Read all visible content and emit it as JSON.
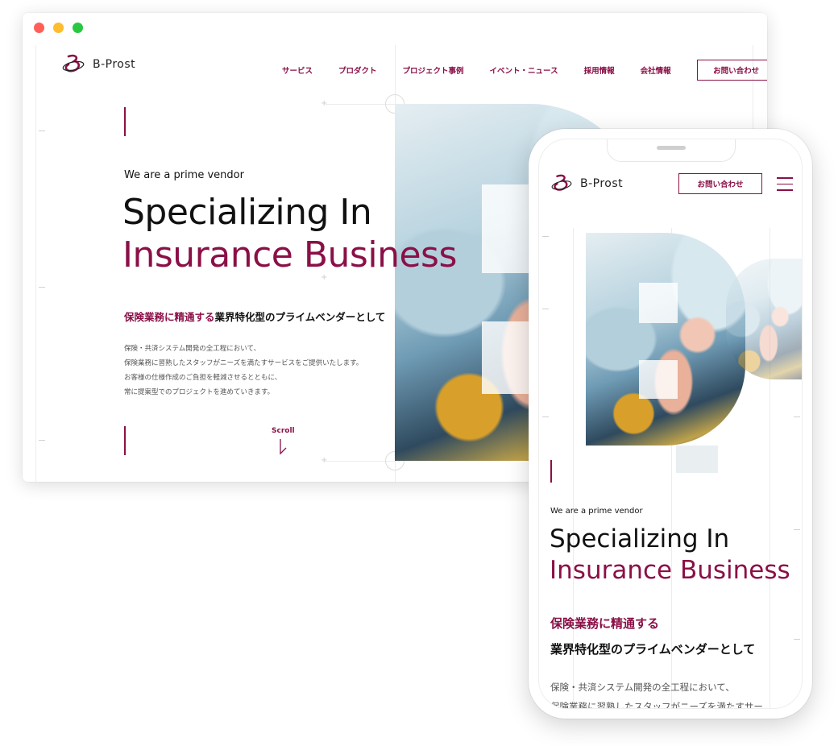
{
  "brand": {
    "name": "B-Prost"
  },
  "desktop": {
    "nav": {
      "items": [
        "サービス",
        "プロダクト",
        "プロジェクト事例",
        "イベント・ニュース",
        "採用情報",
        "会社情報"
      ],
      "contact_label": "お問い合わせ"
    },
    "hero": {
      "eyebrow": "We are a prime vendor",
      "headline_line1": "Specializing In",
      "headline_line2": "Insurance Business",
      "tagline_accent": "保険業務に精通する",
      "tagline_rest": "業界特化型のプライムベンダーとして",
      "body": [
        "保険・共済システム開発の全工程において、",
        "保険業務に習熟したスタッフがニーズを満たすサービスをご提供いたします。",
        "お客様の仕様作成のご負担を軽減させるとともに、",
        "常に提案型でのプロジェクトを進めていきます。"
      ],
      "scroll_label": "Scroll"
    }
  },
  "mobile": {
    "contact_label": "お問い合わせ",
    "hero": {
      "eyebrow": "We are a prime vendor",
      "headline_line1": "Specializing In",
      "headline_line2": "Insurance Business",
      "tagline_line1": "保険業務に精通する",
      "tagline_line2": "業界特化型のプライムベンダーとして",
      "body": [
        "保険・共済システム開発の全工程において、",
        "保険業務に習熟したスタッフがニーズを満たすサー"
      ]
    }
  },
  "colors": {
    "brand": "#8a1047",
    "window_close": "#ff5f57",
    "window_minimize": "#febc2e",
    "window_maximize": "#28c840"
  }
}
